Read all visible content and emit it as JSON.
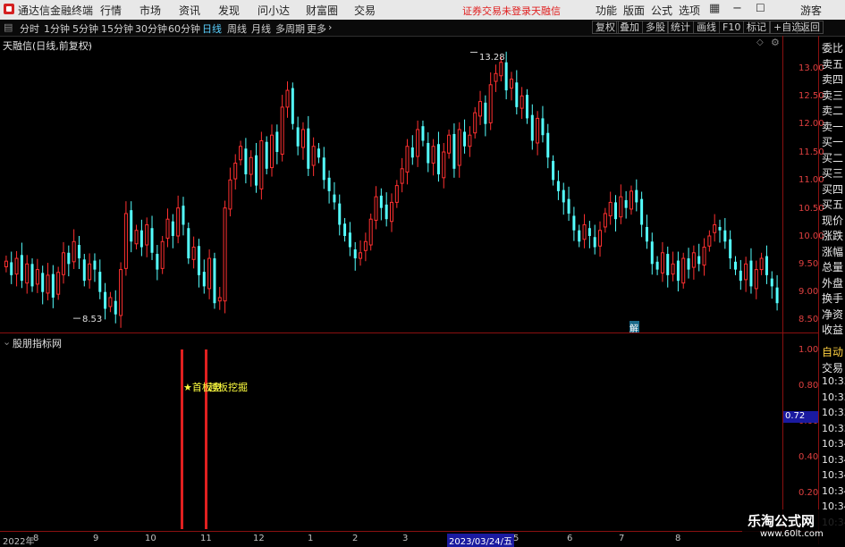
{
  "window": {
    "title": "通达信金融终端",
    "menus": [
      "行情",
      "市场",
      "资讯",
      "发现",
      "问小达",
      "财富圈",
      "交易"
    ],
    "notice": "证券交易未登录",
    "notice2": "天融信",
    "right_menus": [
      "功能",
      "版面",
      "公式",
      "选项"
    ],
    "guest": "游客"
  },
  "toolbar": {
    "periods": [
      "分时",
      "1分钟",
      "5分钟",
      "15分钟",
      "30分钟",
      "60分钟",
      "日线",
      "周线",
      "月线",
      "多周期",
      "更多"
    ],
    "active": "日线",
    "right_buttons": [
      "复权",
      "叠加",
      "多股",
      "统计",
      "画线",
      "F10",
      "标记",
      "+自选",
      "返回"
    ]
  },
  "chart_header": {
    "stock_title": "天融信(日线,前复权)",
    "indicator_title": "股朋指标网"
  },
  "price_axis": [
    "13.00",
    "12.50",
    "12.00",
    "11.50",
    "11.00",
    "10.50",
    "10.00",
    "9.50",
    "9.00",
    "8.50"
  ],
  "price_axis_values": [
    13.0,
    12.5,
    12.0,
    11.5,
    11.0,
    10.5,
    10.0,
    9.5,
    9.0,
    8.5
  ],
  "indicator_axis": [
    "1.00",
    "0.80",
    "0.60",
    "0.40",
    "0.20"
  ],
  "indicator_current": "0.72",
  "extremes": {
    "high_label": "13.28",
    "low_label": "8.53"
  },
  "annotations": {
    "signal_text": "★首板竞",
    "signal_text2": "越板挖掘",
    "jie_badge": "解"
  },
  "x_axis": {
    "labels": [
      "2022年",
      "8",
      "9",
      "10",
      "11",
      "12",
      "1",
      "2",
      "3",
      "2023/03/24/五",
      "5",
      "6",
      "7",
      "8"
    ]
  },
  "side_panel": {
    "top_items": [
      "委比",
      "卖五",
      "卖四",
      "卖三",
      "卖二",
      "卖一",
      "买一",
      "买二",
      "买三",
      "买四",
      "买五",
      "现价",
      "涨跌",
      "涨幅",
      "总量",
      "外盘",
      "换手",
      "净资",
      "收益"
    ],
    "bottom_items": [
      "自动",
      "交易",
      "10:33",
      "10:33",
      "10:33",
      "10:33",
      "10:34",
      "10:34",
      "10:34",
      "10:34",
      "10:34",
      "10:34"
    ]
  },
  "watermark": {
    "line1": "乐淘公式网",
    "line2": "www.60lt.com"
  },
  "chart_data": {
    "type": "candlestick",
    "price_range": [
      8.3,
      13.55
    ],
    "high": 13.28,
    "low": 8.53,
    "closes": [
      9.55,
      9.3,
      9.6,
      9.2,
      9.5,
      9.1,
      9.4,
      9.0,
      9.3,
      8.9,
      9.35,
      9.7,
      9.5,
      9.9,
      9.6,
      9.2,
      9.5,
      9.4,
      9.0,
      8.7,
      8.9,
      8.6,
      9.4,
      10.4,
      9.9,
      10.1,
      9.8,
      10.2,
      9.7,
      9.4,
      9.9,
      10.3,
      10.0,
      10.5,
      10.2,
      9.6,
      9.8,
      9.3,
      9.1,
      9.6,
      8.8,
      8.9,
      10.5,
      11.0,
      11.3,
      11.6,
      11.1,
      11.4,
      10.9,
      11.7,
      11.2,
      11.8,
      11.5,
      12.3,
      12.6,
      12.0,
      11.6,
      11.9,
      11.2,
      11.6,
      11.4,
      11.0,
      10.8,
      10.6,
      10.2,
      10.0,
      9.8,
      9.6,
      9.7,
      9.9,
      10.3,
      10.7,
      10.5,
      10.3,
      10.6,
      10.9,
      11.2,
      11.6,
      11.4,
      11.9,
      11.7,
      11.3,
      11.6,
      11.1,
      11.5,
      11.8,
      11.2,
      11.9,
      11.6,
      11.8,
      12.2,
      12.4,
      12.0,
      12.7,
      12.9,
      13.1,
      12.6,
      12.8,
      12.3,
      12.5,
      12.1,
      11.7,
      12.1,
      11.8,
      11.4,
      11.0,
      10.8,
      10.6,
      10.4,
      10.1,
      9.9,
      10.2,
      10.0,
      9.8,
      10.1,
      10.4,
      10.6,
      10.3,
      10.7,
      10.5,
      10.8,
      10.6,
      10.2,
      9.9,
      9.5,
      9.4,
      9.7,
      9.3,
      9.5,
      9.2,
      9.6,
      9.4,
      9.7,
      9.5,
      9.8,
      10.0,
      10.2,
      10.1,
      9.9,
      9.6,
      9.4,
      9.2,
      9.5,
      9.1,
      9.4,
      9.6,
      9.3,
      9.1,
      8.8
    ]
  },
  "indicator_signals": [
    0.2,
    0.0
  ],
  "colors": {
    "up": "#ff3030",
    "down": "#54ffff",
    "axis": "#e04040",
    "panel_line": "#8a1010",
    "highlight": "#1a1aa0",
    "signal": "#ffff40"
  }
}
